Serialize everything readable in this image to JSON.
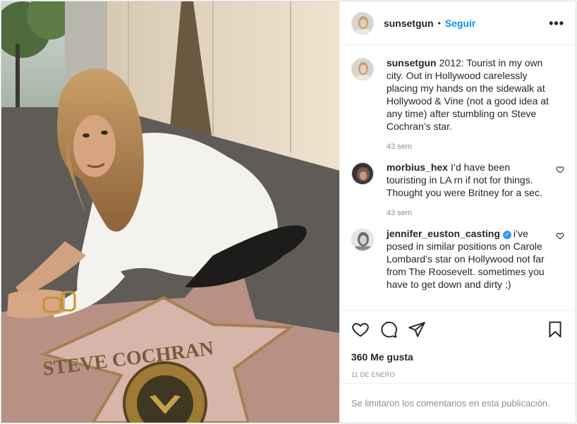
{
  "photo": {
    "description_icon": "hollywood-walk-of-fame-photo",
    "star_name": "STEVE COCHRAN"
  },
  "header": {
    "username": "sunsetgun",
    "separator": "•",
    "follow_label": "Seguir",
    "more_label": "•••"
  },
  "comments": [
    {
      "username": "sunsetgun",
      "text": "2012: Tourist in my own city. Out in Hollywood carelessly placing my hands on the sidewalk at Hollywood & Vine (not a good idea at any time) after stumbling on Steve Cochran’s star.",
      "time": "43 sem"
    },
    {
      "username": "morbius_hex",
      "text": "I’d have been touristing in LA rn if not for things. Thought you were Britney for a sec.",
      "time": "43 sem"
    },
    {
      "username": "jennifer_euston_casting",
      "verified_mark": "✓",
      "text": "i’ve posed in similar positions on Carole Lombard’s star on Hollywood not far from The Roosevelt. sometimes you have to get down and dirty ;)"
    }
  ],
  "actions": {
    "likes": "360 Me gusta",
    "date": "11 DE ENERO"
  },
  "footer": {
    "comments_closed": "Se limitaron los comentarios en esta publicación."
  },
  "colors": {
    "accent": "#0095f6",
    "muted": "#8e8e8e",
    "verified": "#3897f0"
  }
}
